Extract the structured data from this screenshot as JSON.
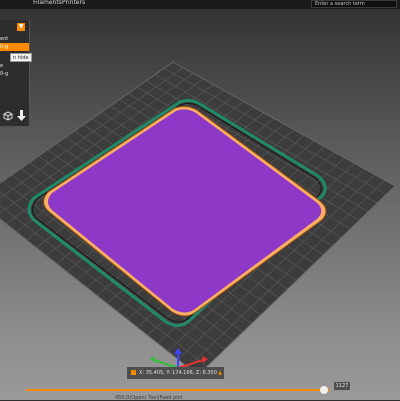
{
  "topbar": {
    "filaments_label": "Filaments",
    "printers_label": "Printers",
    "search_placeholder": "Enter a search term"
  },
  "panel": {
    "rows": [
      "ent",
      "0-g",
      "e",
      "0-g"
    ],
    "tooltip": "n hide"
  },
  "status": {
    "coords": "X: 35.405, Y: 174.166, Z: 6.350"
  },
  "layer_slider": {
    "value_label": "1127",
    "position_fraction": 0.98
  },
  "legend": {
    "text": "450.0(Open) Tool/Feed plot"
  },
  "colors": {
    "accent": "#ff8a00",
    "bed": "#3c3c3c",
    "part": "#8e38c8",
    "skirt": "#1f8a6a"
  },
  "icons": {
    "cube": "cube-icon",
    "download": "download-icon",
    "axis": "axis-gizmo-icon"
  }
}
